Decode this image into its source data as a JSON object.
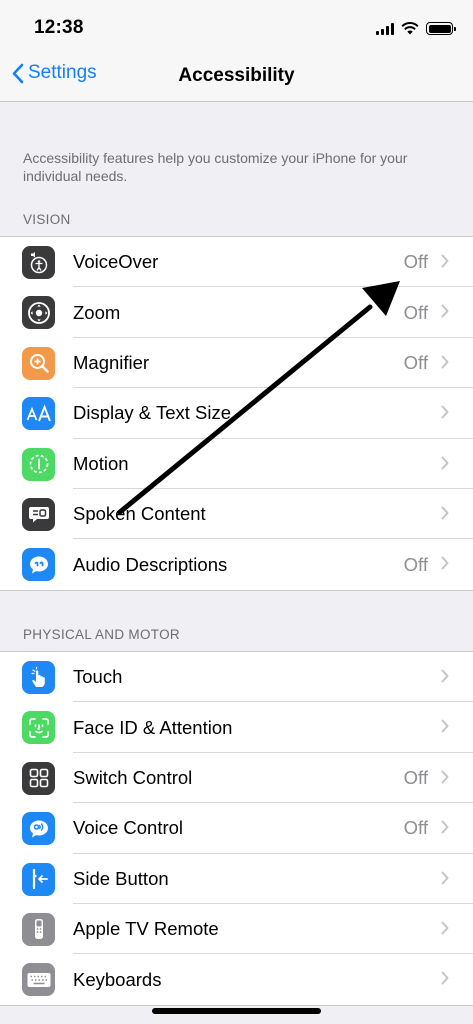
{
  "status_bar": {
    "time": "12:38"
  },
  "nav": {
    "back_label": "Settings",
    "title": "Accessibility"
  },
  "description": "Accessibility features help you customize your iPhone for your individual needs.",
  "sections": {
    "vision": {
      "header": "VISION",
      "items": [
        {
          "label": "VoiceOver",
          "value": "Off",
          "icon": "voiceover-icon",
          "color": "#3a3a3c"
        },
        {
          "label": "Zoom",
          "value": "Off",
          "icon": "zoom-icon",
          "color": "#3a3a3c"
        },
        {
          "label": "Magnifier",
          "value": "Off",
          "icon": "magnifier-icon",
          "color": "#f2994a"
        },
        {
          "label": "Display & Text Size",
          "value": "",
          "icon": "text-size-icon",
          "color": "#1e88f5"
        },
        {
          "label": "Motion",
          "value": "",
          "icon": "motion-icon",
          "color": "#4cd964"
        },
        {
          "label": "Spoken Content",
          "value": "",
          "icon": "spoken-content-icon",
          "color": "#3a3a3c"
        },
        {
          "label": "Audio Descriptions",
          "value": "Off",
          "icon": "audio-descriptions-icon",
          "color": "#1e88f5"
        }
      ]
    },
    "physical": {
      "header": "PHYSICAL AND MOTOR",
      "items": [
        {
          "label": "Touch",
          "value": "",
          "icon": "touch-icon",
          "color": "#1e88f5"
        },
        {
          "label": "Face ID & Attention",
          "value": "",
          "icon": "face-id-icon",
          "color": "#4cd964"
        },
        {
          "label": "Switch Control",
          "value": "Off",
          "icon": "switch-control-icon",
          "color": "#3a3a3c"
        },
        {
          "label": "Voice Control",
          "value": "Off",
          "icon": "voice-control-icon",
          "color": "#1e88f5"
        },
        {
          "label": "Side Button",
          "value": "",
          "icon": "side-button-icon",
          "color": "#1e88f5"
        },
        {
          "label": "Apple TV Remote",
          "value": "",
          "icon": "apple-tv-remote-icon",
          "color": "#8e8e93"
        },
        {
          "label": "Keyboards",
          "value": "",
          "icon": "keyboard-icon",
          "color": "#8e8e93"
        }
      ]
    }
  },
  "colors": {
    "accent": "#147efb",
    "annotation_arrow": "#000000"
  }
}
